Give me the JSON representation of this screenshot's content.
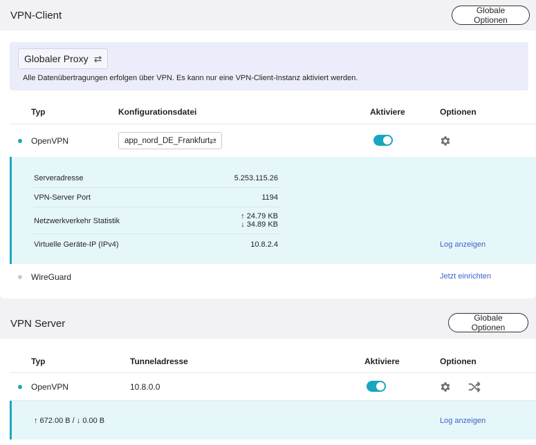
{
  "vpn_client": {
    "title": "VPN-Client",
    "global_options_label": "Globale Optionen",
    "proxy_button_label": "Globaler Proxy",
    "proxy_info_text": "Alle Datenübertragungen erfolgen über VPN. Es kann nur eine VPN-Client-Instanz aktiviert werden.",
    "headers": {
      "type": "Typ",
      "config": "Konfigurationsdatei",
      "activate": "Aktiviere",
      "options": "Optionen"
    },
    "rows": [
      {
        "type": "OpenVPN",
        "config": "app_nord_DE_Frankfurt",
        "active": true,
        "status_color": "#1aa6c0"
      },
      {
        "type": "WireGuard",
        "action_link": "Jetzt einrichten",
        "status_color": "#c8c8c8"
      }
    ],
    "details": {
      "server_address_label": "Serveradresse",
      "server_address": "5.253.115.26",
      "server_port_label": "VPN-Server Port",
      "server_port": "1194",
      "traffic_label": "Netzwerkverkehr Statistik",
      "traffic_up": "24.79 KB",
      "traffic_down": "34.89 KB",
      "virtual_ip_label": "Virtuelle Geräte-IP (IPv4)",
      "virtual_ip": "10.8.2.4",
      "log_link": "Log anzeigen"
    }
  },
  "vpn_server": {
    "title": "VPN Server",
    "global_options_label": "Globale Optionen",
    "headers": {
      "type": "Typ",
      "tunnel": "Tunneladresse",
      "activate": "Aktiviere",
      "options": "Optionen"
    },
    "rows": [
      {
        "type": "OpenVPN",
        "tunnel": "10.8.0.0",
        "active": true,
        "status_color": "#1aa6c0"
      }
    ],
    "details": {
      "traffic": "↑ 672.00 B / ↓ 0.00 B",
      "log_link": "Log anzeigen"
    }
  }
}
